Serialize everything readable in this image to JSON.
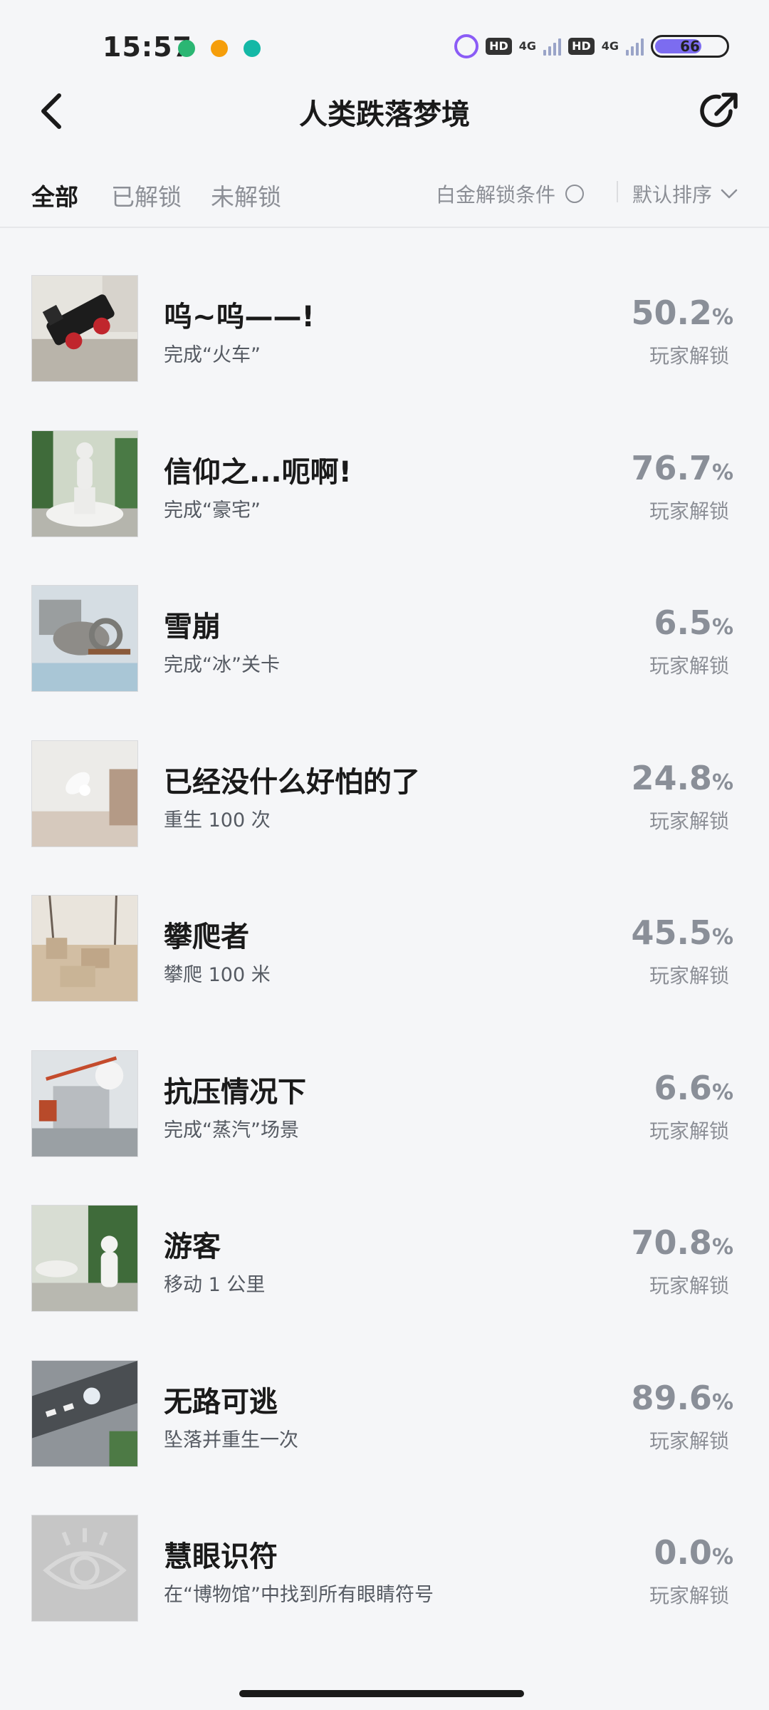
{
  "status_bar": {
    "time": "15:57",
    "net_label_1": "4G",
    "hd_label_1": "HD",
    "net_label_2": "4G",
    "hd_label_2": "HD",
    "battery": "66"
  },
  "header": {
    "title": "人类跌落梦境"
  },
  "filters": {
    "tabs": [
      "全部",
      "已解锁",
      "未解锁"
    ],
    "platinum_label": "白金解锁条件",
    "sort_label": "默认排序"
  },
  "achievements": [
    {
      "title": "呜~呜——!",
      "desc": "完成“火车”",
      "percent": "50.2",
      "percent_sign": "%",
      "unlock_label": "玩家解锁"
    },
    {
      "title": "信仰之...呃啊!",
      "desc": "完成“豪宅”",
      "percent": "76.7",
      "percent_sign": "%",
      "unlock_label": "玩家解锁"
    },
    {
      "title": "雪崩",
      "desc": "完成“冰”关卡",
      "percent": "6.5",
      "percent_sign": "%",
      "unlock_label": "玩家解锁"
    },
    {
      "title": "已经没什么好怕的了",
      "desc": "重生 100 次",
      "percent": "24.8",
      "percent_sign": "%",
      "unlock_label": "玩家解锁"
    },
    {
      "title": "攀爬者",
      "desc": "攀爬 100 米",
      "percent": "45.5",
      "percent_sign": "%",
      "unlock_label": "玩家解锁"
    },
    {
      "title": "抗压情况下",
      "desc": "完成“蒸汽”场景",
      "percent": "6.6",
      "percent_sign": "%",
      "unlock_label": "玩家解锁"
    },
    {
      "title": "游客",
      "desc": "移动 1 公里",
      "percent": "70.8",
      "percent_sign": "%",
      "unlock_label": "玩家解锁"
    },
    {
      "title": "无路可逃",
      "desc": "坠落并重生一次",
      "percent": "89.6",
      "percent_sign": "%",
      "unlock_label": "玩家解锁"
    },
    {
      "title": "慧眼识符",
      "desc": "在“博物馆”中找到所有眼睛符号",
      "percent": "0.0",
      "percent_sign": "%",
      "unlock_label": "玩家解锁"
    }
  ]
}
